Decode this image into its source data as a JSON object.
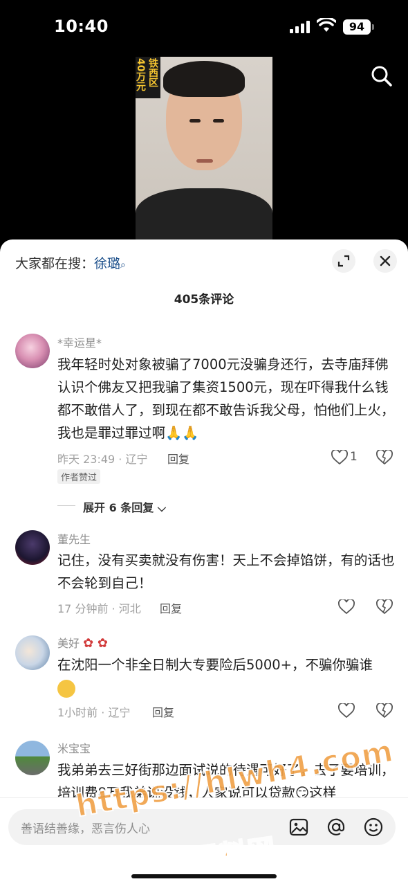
{
  "status_bar": {
    "time": "10:40",
    "battery": "94"
  },
  "video": {
    "banner_text": "铁西区40万元"
  },
  "sheet": {
    "hot_search_label": "大家都在搜：",
    "hot_search_keyword": "徐璐",
    "title": "405条评论"
  },
  "comments": [
    {
      "user": "*幸运星*",
      "text": "我年轻时处对象被骗了7000元没骗身还行，去寺庙拜佛认识个佛友又把我骗了集资1500元，现在吓得我什么钱都不敢借人了，到现在都不敢告诉我父母，怕他们上火，我也是罪过罪过啊🙏🙏",
      "meta": "昨天 23:49 · 辽宁",
      "reply": "回复",
      "likes": "1",
      "author_liked": "作者赞过",
      "expand": "展开 6 条回复"
    },
    {
      "user": "董先生",
      "text": "记住，没有买卖就没有伤害！天上不会掉馅饼，有的话也不会轮到自己！",
      "meta": "17 分钟前 · 河北",
      "reply": "回复"
    },
    {
      "user": "美好",
      "text": "在沈阳一个非全日制大专要险后5000+，不骗你骗谁",
      "meta": "1小时前 · 辽宁",
      "reply": "回复"
    },
    {
      "user": "米宝宝",
      "text": "我弟弟去三好街那边面试说的待遇可好了，去了要培训，培训费8万我弟说没钱，人家说可以贷款😏这样"
    }
  ],
  "input": {
    "placeholder": "善语结善缘，恶言伤人心"
  },
  "watermark": {
    "line1": "https://hlwh4.com",
    "line2": "黑料网"
  },
  "icons": [
    "search-icon",
    "expand-icon",
    "close-icon",
    "like-icon",
    "dislike-icon",
    "image-icon",
    "at-icon",
    "emoji-icon",
    "chevron-down-icon"
  ]
}
